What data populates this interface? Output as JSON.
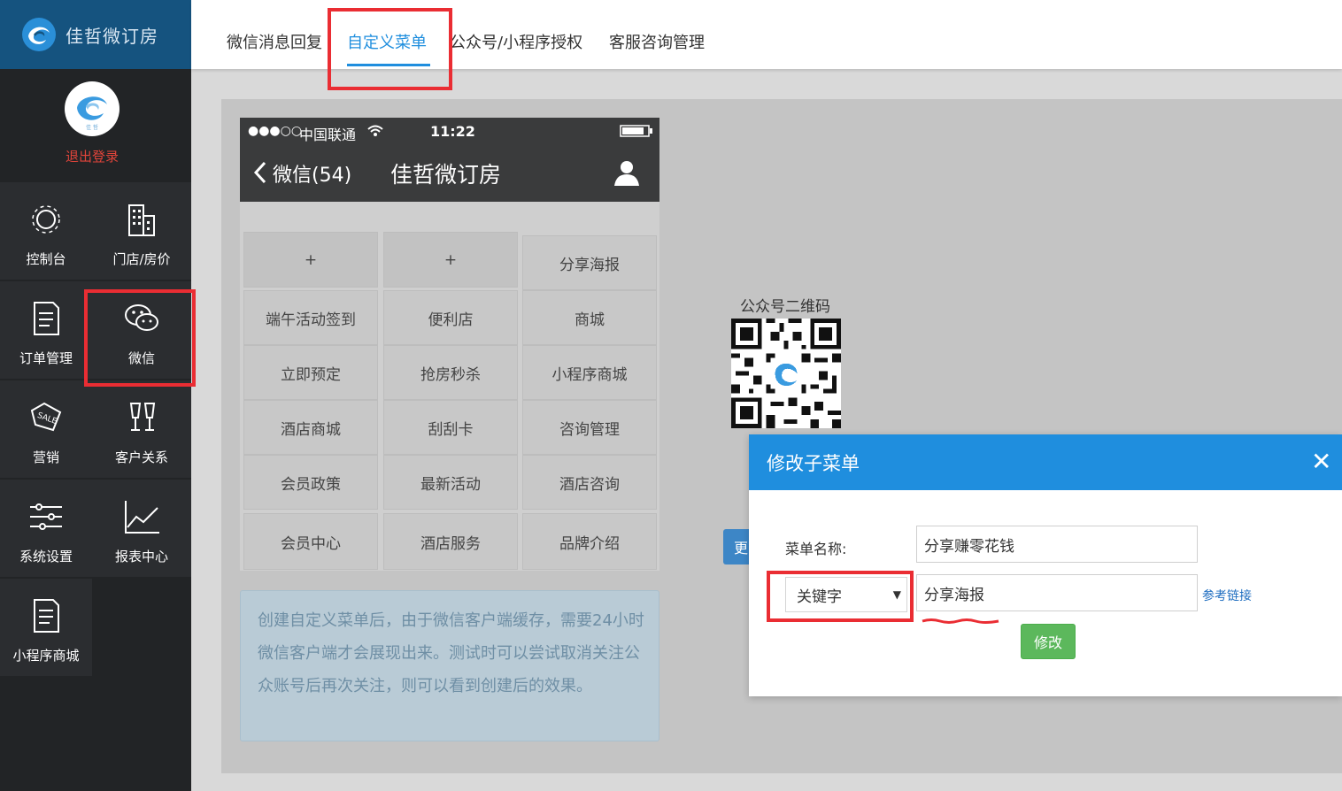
{
  "brand": {
    "name": "佳哲微订房",
    "avatar_caption": "佳 哲"
  },
  "profile": {
    "logout": "退出登录"
  },
  "sidebar": {
    "items": [
      {
        "label": "控制台",
        "icon": "sun-gear-icon"
      },
      {
        "label": "门店/房价",
        "icon": "building-icon"
      },
      {
        "label": "订单管理",
        "icon": "document-icon"
      },
      {
        "label": "微信",
        "icon": "wechat-icon"
      },
      {
        "label": "营销",
        "icon": "sale-tag-icon"
      },
      {
        "label": "客户关系",
        "icon": "glasses-icon"
      },
      {
        "label": "系统设置",
        "icon": "sliders-icon"
      },
      {
        "label": "报表中心",
        "icon": "chart-icon"
      },
      {
        "label": "小程序商城",
        "icon": "document-icon"
      }
    ]
  },
  "tabs": [
    {
      "label": "微信消息回复"
    },
    {
      "label": "自定义菜单"
    },
    {
      "label": "公众号/小程序授权"
    },
    {
      "label": "客服咨询管理"
    }
  ],
  "phone": {
    "signal": "●●●○○",
    "carrier": "中国联通",
    "time": "11:22",
    "back": "微信(54)",
    "title": "佳哲微订房",
    "columns": [
      [
        "+",
        "端午活动签到",
        "立即预定",
        "酒店商城",
        "会员政策",
        "会员中心"
      ],
      [
        "+",
        "便利店",
        "抢房秒杀",
        "刮刮卡",
        "最新活动",
        "酒店服务"
      ],
      [
        "分享海报",
        "商城",
        "小程序商城",
        "咨询管理",
        "酒店咨询",
        "品牌介绍"
      ]
    ]
  },
  "notice": {
    "text": "创建自定义菜单后，由于微信客户端缓存，需要24小时微信客户端才会展现出来。测试时可以尝试取消关注公众账号后再次关注，则可以看到创建后的效果。"
  },
  "qr": {
    "label": "公众号二维码"
  },
  "update_button": {
    "label": "更"
  },
  "modal": {
    "title": "修改子菜单",
    "close": "✕",
    "name_label": "菜单名称:",
    "name_value": "分享赚零花钱",
    "type_selected": "关键字",
    "keyword_value": "分享海报",
    "ref_link": "参考链接",
    "save": "修改"
  },
  "colors": {
    "accent": "#1f8ede",
    "highlight": "#ea2d33",
    "success": "#5cb85c",
    "sidebar": "#222426",
    "brand_bar": "#15537f"
  }
}
